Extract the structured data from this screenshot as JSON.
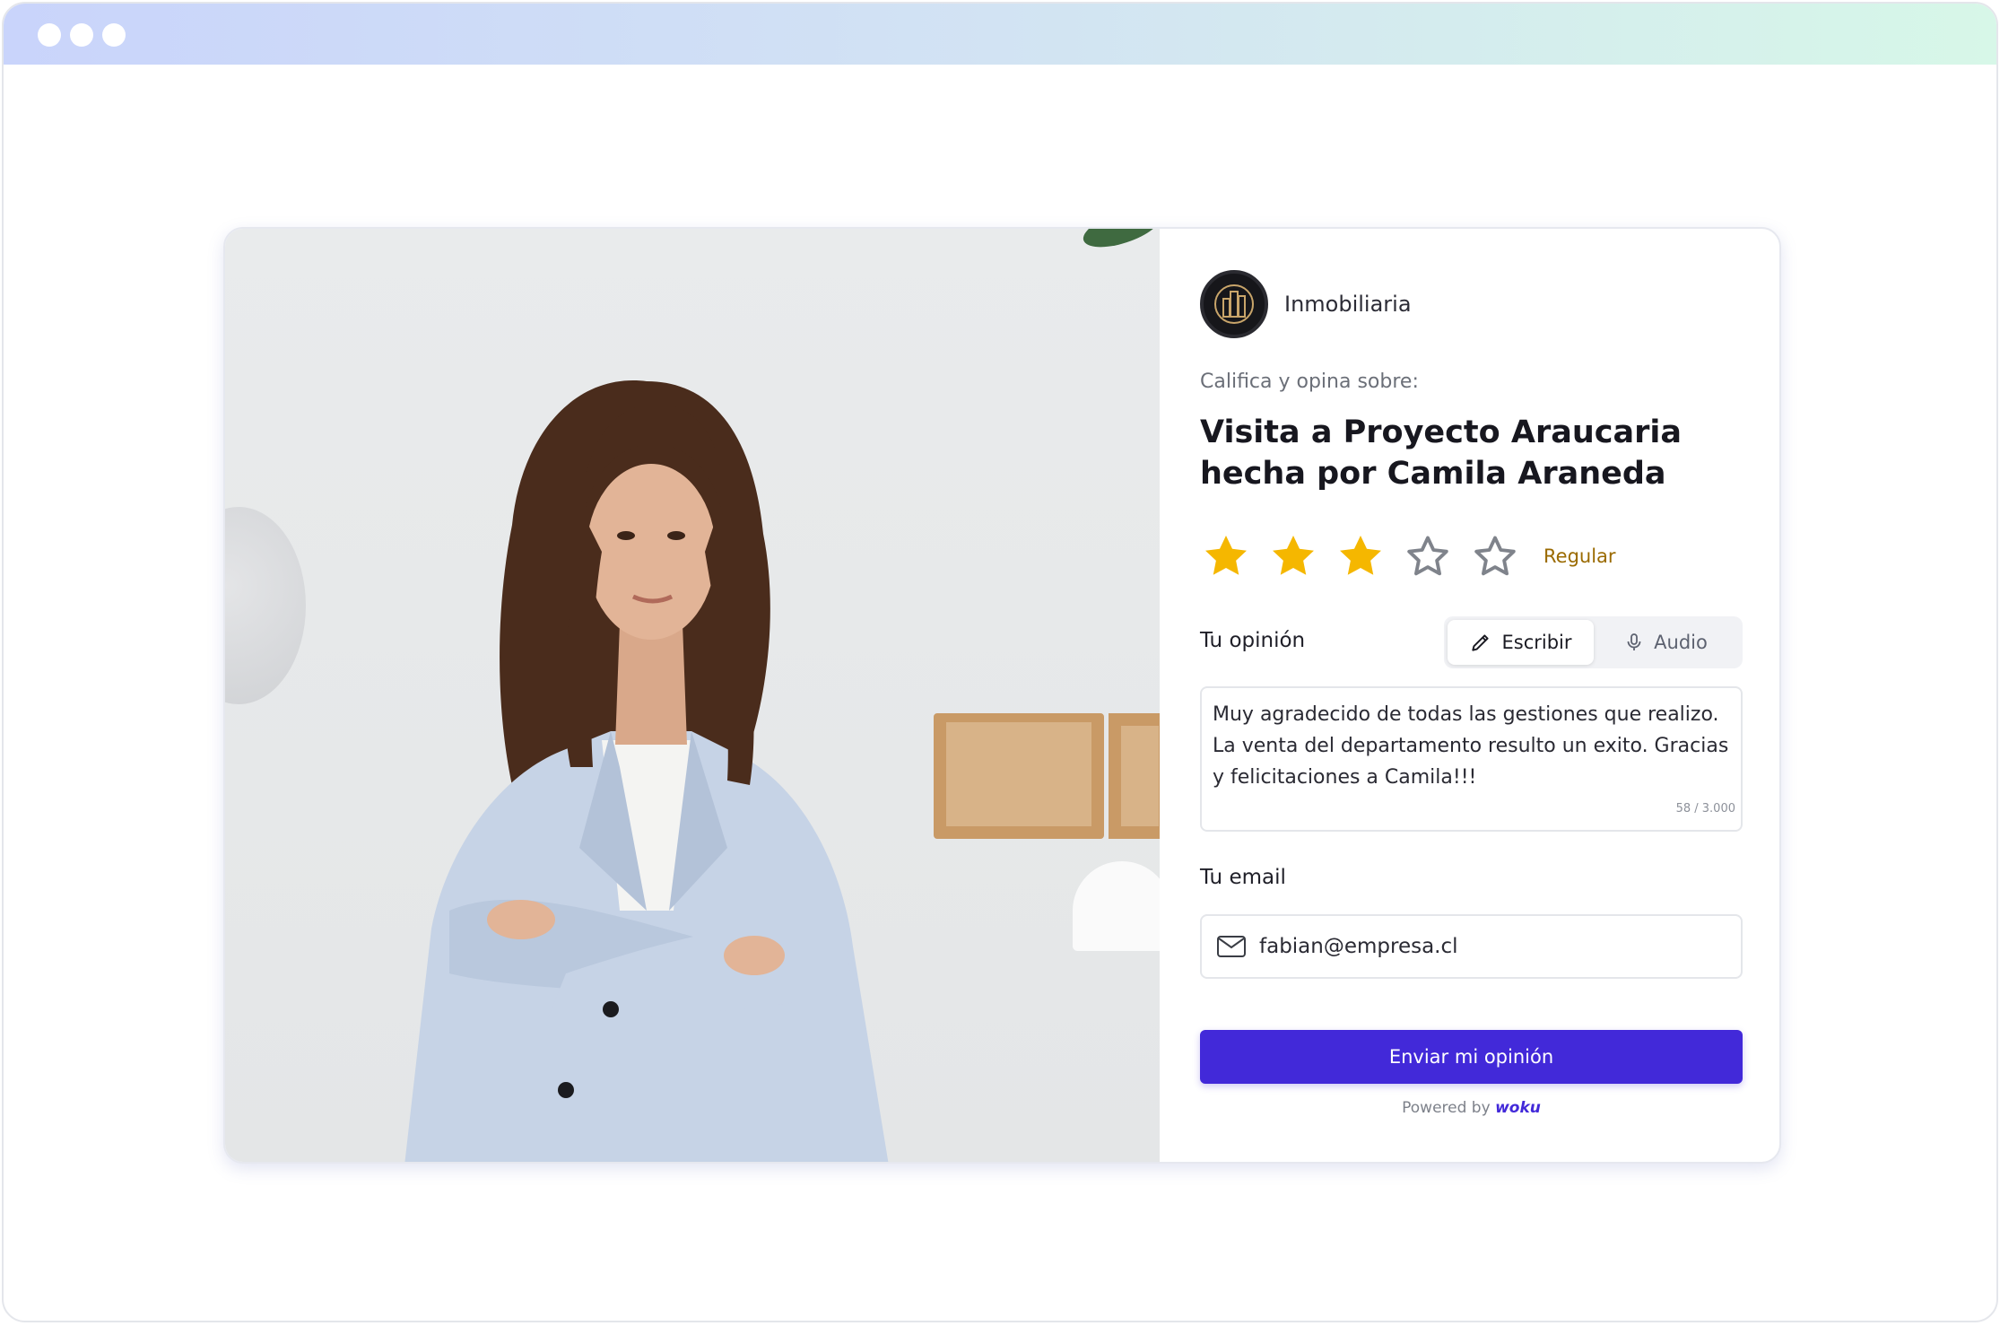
{
  "window": {
    "controls": [
      "close-dot",
      "minimize-dot",
      "maximize-dot"
    ]
  },
  "company": {
    "name": "Inmobiliaria",
    "logo_icon": "buildings-icon"
  },
  "form": {
    "subtitle": "Califica y opina sobre:",
    "title": "Visita a Proyecto Araucaria hecha por Camila Araneda",
    "rating": {
      "value": 3,
      "max": 5,
      "label": "Regular",
      "filled_color": "#F5B700"
    },
    "opinion": {
      "label": "Tu opinión",
      "modes": [
        {
          "label": "Escribir",
          "icon": "pencil-icon",
          "active": true
        },
        {
          "label": "Audio",
          "icon": "microphone-icon",
          "active": false
        }
      ],
      "text": "Muy agradecido de todas las gestiones que realizo. La venta del departamento resulto un exito. Gracias y felicitaciones a Camila!!!",
      "counter": "58 / 3.000"
    },
    "email": {
      "label": "Tu email",
      "value": "fabian@empresa.cl",
      "icon": "mail-icon"
    },
    "submit_label": "Enviar mi opinión",
    "powered_prefix": "Powered by",
    "powered_brand": "woku"
  },
  "colors": {
    "primary": "#4229D9",
    "star": "#F5B700",
    "rating_label": "#9A6A00"
  }
}
